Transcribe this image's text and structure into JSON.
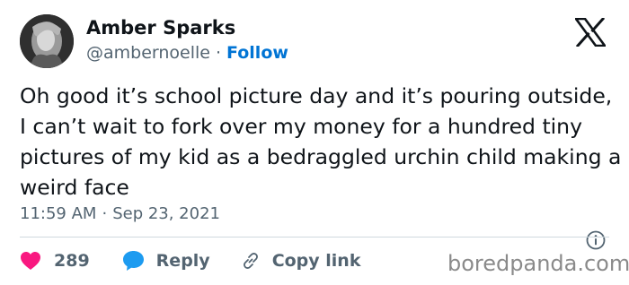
{
  "author": {
    "name": "Amber Sparks",
    "handle": "@ambernoelle",
    "separator": "·",
    "follow_label": "Follow"
  },
  "tweet": {
    "text": "Oh good it’s school picture day and it’s pouring outside, I can’t wait to fork over my money for a hundred tiny pictures of my kid as a bedraggled urchin child making a weird face",
    "time": "11:59 AM",
    "separator": "·",
    "date": "Sep 23, 2021"
  },
  "actions": {
    "like_count": "289",
    "reply_label": "Reply",
    "copy_link_label": "Copy link"
  },
  "watermark": "boredpanda.com",
  "icons": {
    "brand": "x-logo-icon",
    "info": "info-icon",
    "like": "heart-icon",
    "reply": "reply-bubble-icon",
    "copy": "link-icon"
  },
  "colors": {
    "text": "#0f1419",
    "secondary": "#536471",
    "follow": "#0074d4",
    "like": "#f91880",
    "reply": "#1d9bf0",
    "divider": "#cfd9de"
  }
}
